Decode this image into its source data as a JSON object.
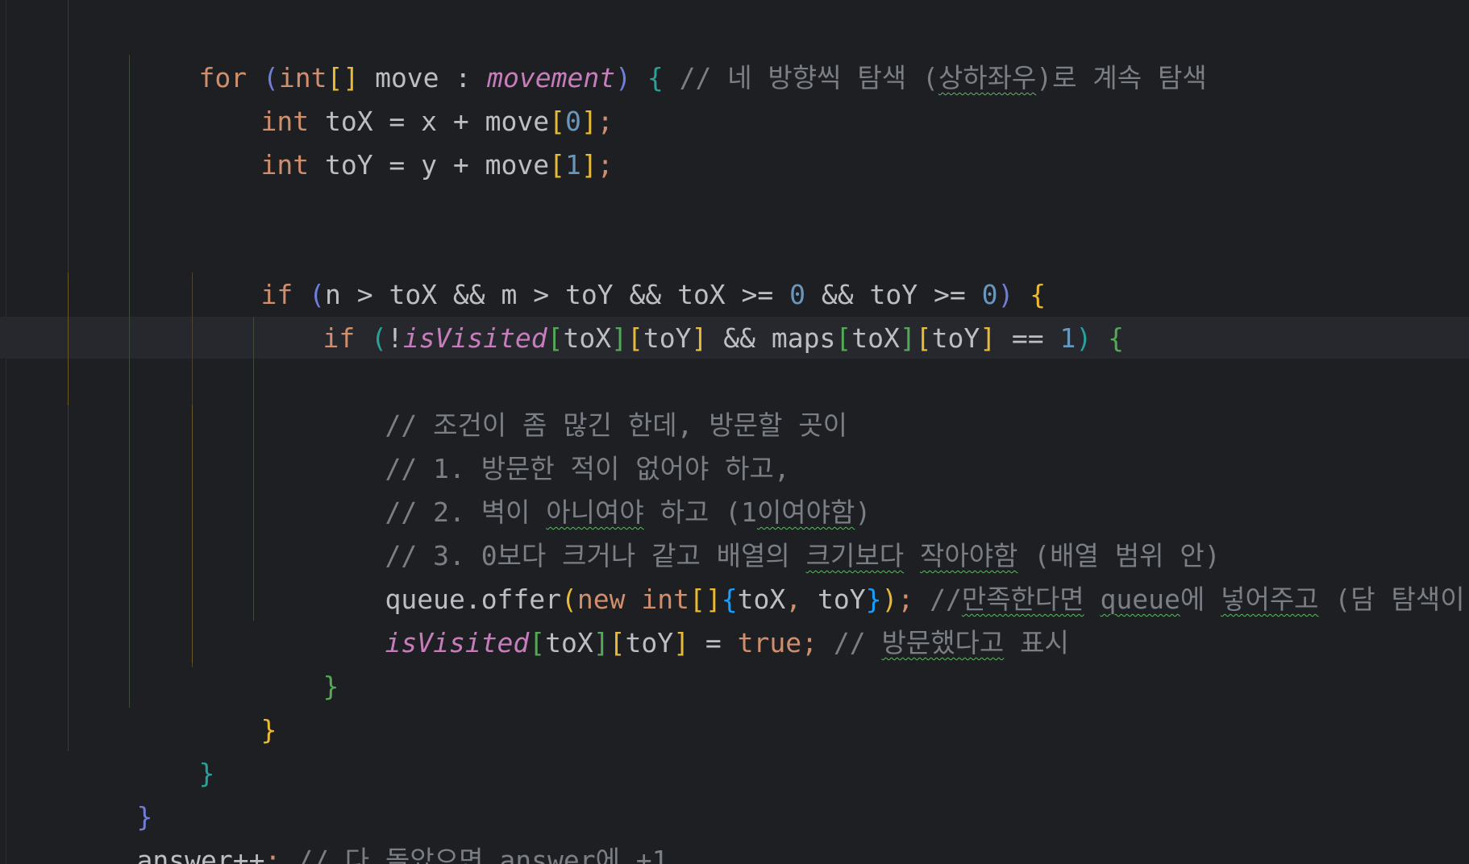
{
  "editor": {
    "lines": [
      {
        "tokens": [
          "for",
          " ",
          "(",
          "int",
          "[]",
          " move : ",
          "movement",
          ")",
          " ",
          "{",
          " // 네 방향씩 탐색 (",
          "상하좌우",
          ")로 계속 탐색"
        ]
      },
      {
        "tokens": [
          "int",
          " toX = x + move",
          "[",
          "0",
          "]",
          ";"
        ]
      },
      {
        "tokens": [
          "int",
          " toY = y + move",
          "[",
          "1",
          "]",
          ";"
        ]
      },
      {
        "tokens": [
          "if",
          " ",
          "(",
          "n > toX && m > toY && toX >= ",
          "0",
          " && toY >= ",
          "0",
          ")",
          " ",
          "{"
        ]
      },
      {
        "tokens": [
          "if",
          " ",
          "(",
          "!",
          "isVisited",
          "[",
          "toX",
          "]",
          "[",
          "toY",
          "]",
          " && maps",
          "[",
          "toX",
          "]",
          "[",
          "toY",
          "]",
          " == ",
          "1",
          ")",
          " ",
          "{"
        ]
      },
      {
        "tokens": [
          "// 조건이 좀 많긴 한데, 방문할 곳이"
        ]
      },
      {
        "tokens": [
          "// 1. 방문한 적이 없어야 하고,"
        ]
      },
      {
        "tokens": [
          "// 2. 벽이 ",
          "아니여야",
          " 하고 (1",
          "이여야함",
          ")"
        ]
      },
      {
        "tokens": [
          "// 3. 0보다 크거나 같고 배열의 ",
          "크기보다",
          " ",
          "작아야함",
          " (배열 범위 안)"
        ]
      },
      {
        "tokens": [
          "queue.offer",
          "(",
          "new",
          " ",
          "int",
          "[]",
          "{",
          "toX",
          ", ",
          "toY",
          "}",
          ")",
          ";",
          " //",
          "만족한다면",
          " ",
          "queue",
          "에 ",
          "넣어주고",
          " (담 탐색이 되니까)"
        ]
      },
      {
        "tokens": [
          "isVisited",
          "[",
          "toX",
          "]",
          "[",
          "toY",
          "]",
          " = ",
          "true",
          ";",
          " // ",
          "방문했다고",
          " 표시"
        ]
      },
      {
        "tokens": [
          "}"
        ]
      },
      {
        "tokens": [
          "}"
        ]
      },
      {
        "tokens": [
          "}"
        ]
      },
      {
        "tokens": [
          "}"
        ]
      },
      {
        "tokens": [
          "answer",
          "++",
          ";",
          " // 다 ",
          "돌았으면",
          " ",
          "answer",
          "에 +1"
        ]
      }
    ]
  },
  "colors": {
    "background": "#1e1f22",
    "caret_row": "#26282e",
    "keyword": "#cf8e6d",
    "comment": "#7a7e85",
    "field": "#c77dbb",
    "number": "#2aacb8",
    "plain": "#bcbec4",
    "bracket_yellow": "#e8ba36",
    "bracket_green": "#54a857",
    "bracket_blue": "#6e7ed9",
    "typo_underline": "#5fb865"
  }
}
